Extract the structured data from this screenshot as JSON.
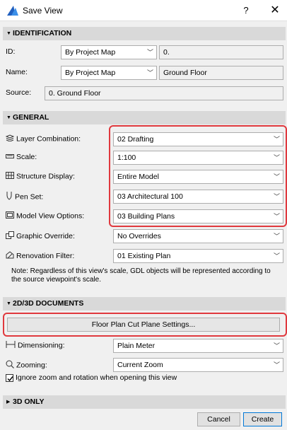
{
  "window": {
    "title": "Save View",
    "help": "?",
    "close": "✕"
  },
  "identification": {
    "header": "IDENTIFICATION",
    "id_label": "ID:",
    "id_mode": "By Project Map",
    "id_value": "0.",
    "name_label": "Name:",
    "name_mode": "By Project Map",
    "name_value": "Ground Floor",
    "source_label": "Source:",
    "source_value": "0. Ground Floor"
  },
  "general": {
    "header": "GENERAL",
    "rows": [
      {
        "label": "Layer Combination:",
        "value": "02 Drafting",
        "icon": "layers-icon"
      },
      {
        "label": "Scale:",
        "value": "1:100",
        "icon": "ruler-icon"
      },
      {
        "label": "Structure Display:",
        "value": "Entire Model",
        "icon": "structure-icon"
      },
      {
        "label": "Pen Set:",
        "value": "03 Architectural 100",
        "icon": "pen-icon"
      },
      {
        "label": "Model View Options:",
        "value": "03 Building Plans",
        "icon": "model-view-icon"
      },
      {
        "label": "Graphic Override:",
        "value": "No Overrides",
        "icon": "graphic-override-icon"
      },
      {
        "label": "Renovation Filter:",
        "value": "01 Existing Plan",
        "icon": "renovation-icon"
      }
    ],
    "note": "Note: Regardless of this view's scale, GDL objects will be represented according to the source viewpoint's scale."
  },
  "documents": {
    "header": "2D/3D DOCUMENTS",
    "cut_plane_button": "Floor Plan Cut Plane Settings...",
    "dimensioning_label": "Dimensioning:",
    "dimensioning_value": "Plain Meter",
    "zooming_label": "Zooming:",
    "zooming_value": "Current Zoom",
    "ignore_zoom_label": "Ignore zoom and rotation when opening this view"
  },
  "threed": {
    "header": "3D ONLY"
  },
  "footer": {
    "cancel": "Cancel",
    "create": "Create"
  }
}
